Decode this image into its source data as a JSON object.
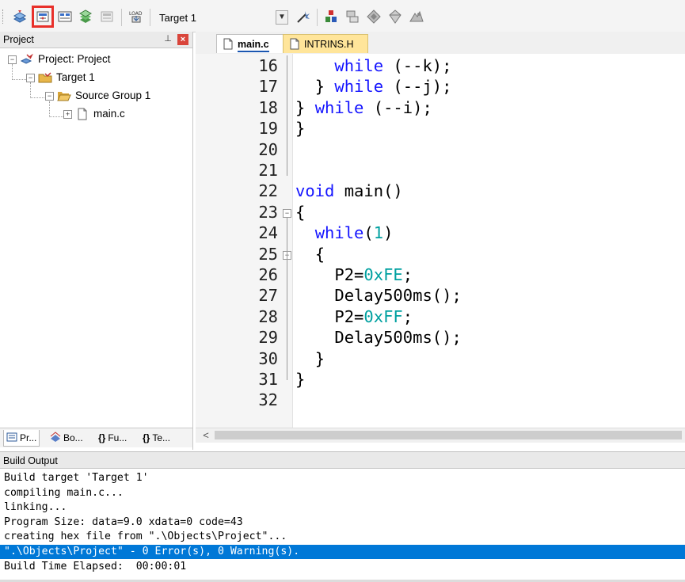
{
  "toolbar": {
    "target_select_value": "Target 1",
    "buttons": [
      "translate-icon",
      "build-icon",
      "rebuild-icon",
      "batch-build-icon",
      "stop-build-icon",
      "download-icon",
      "target-options-icon",
      "manage-components-icon",
      "file-extensions-icon",
      "select-packs-icon",
      "pack-installer-icon",
      "event-recorder-icon"
    ],
    "highlight_color": "#e8302a"
  },
  "project_panel": {
    "title": "Project",
    "pin_glyph": "⊥",
    "close_glyph": "×",
    "tree": {
      "root": "Project: Project",
      "target": "Target 1",
      "group": "Source Group 1",
      "file": "main.c"
    },
    "tabs": [
      "Pr...",
      "Bo...",
      "Fu...",
      "Te..."
    ]
  },
  "editor": {
    "tabs": [
      {
        "label": "main.c",
        "active": true
      },
      {
        "label": "INTRINS.H",
        "active": false
      }
    ],
    "lines": [
      {
        "n": "16",
        "indent": "    ",
        "parts": [
          {
            "t": "while",
            "c": "kw"
          },
          {
            "t": " (--k);",
            "c": ""
          }
        ]
      },
      {
        "n": "17",
        "indent": "  ",
        "parts": [
          {
            "t": "} ",
            "c": ""
          },
          {
            "t": "while",
            "c": "kw"
          },
          {
            "t": " (--j);",
            "c": ""
          }
        ]
      },
      {
        "n": "18",
        "indent": "",
        "parts": [
          {
            "t": "} ",
            "c": ""
          },
          {
            "t": "while",
            "c": "kw"
          },
          {
            "t": " (--i);",
            "c": ""
          }
        ]
      },
      {
        "n": "19",
        "indent": "",
        "parts": [
          {
            "t": "}",
            "c": ""
          }
        ]
      },
      {
        "n": "20",
        "indent": "",
        "parts": []
      },
      {
        "n": "21",
        "indent": "",
        "parts": []
      },
      {
        "n": "22",
        "indent": "",
        "parts": [
          {
            "t": "void",
            "c": "kw"
          },
          {
            "t": " main()",
            "c": ""
          }
        ]
      },
      {
        "n": "23",
        "indent": "",
        "parts": [
          {
            "t": "{",
            "c": ""
          }
        ]
      },
      {
        "n": "24",
        "indent": "  ",
        "parts": [
          {
            "t": "while",
            "c": "kw"
          },
          {
            "t": "(",
            "c": ""
          },
          {
            "t": "1",
            "c": "num"
          },
          {
            "t": ")",
            "c": ""
          }
        ]
      },
      {
        "n": "25",
        "indent": "  ",
        "parts": [
          {
            "t": "{",
            "c": ""
          }
        ]
      },
      {
        "n": "26",
        "indent": "    ",
        "parts": [
          {
            "t": "P2=",
            "c": ""
          },
          {
            "t": "0xFE",
            "c": "num"
          },
          {
            "t": ";",
            "c": ""
          }
        ]
      },
      {
        "n": "27",
        "indent": "    ",
        "parts": [
          {
            "t": "Delay500ms();",
            "c": ""
          }
        ]
      },
      {
        "n": "28",
        "indent": "    ",
        "parts": [
          {
            "t": "P2=",
            "c": ""
          },
          {
            "t": "0xFF",
            "c": "num"
          },
          {
            "t": ";",
            "c": ""
          }
        ]
      },
      {
        "n": "29",
        "indent": "    ",
        "parts": [
          {
            "t": "Delay500ms();",
            "c": ""
          }
        ]
      },
      {
        "n": "30",
        "indent": "  ",
        "parts": [
          {
            "t": "}",
            "c": ""
          }
        ]
      },
      {
        "n": "31",
        "indent": "",
        "parts": [
          {
            "t": "}",
            "c": ""
          }
        ]
      },
      {
        "n": "32",
        "indent": "",
        "parts": []
      }
    ],
    "fold_glyph": "−",
    "scroll_left_glyph": "<"
  },
  "build_output": {
    "title": "Build Output",
    "lines": [
      "Build target 'Target 1'",
      "compiling main.c...",
      "linking...",
      "Program Size: data=9.0 xdata=0 code=43",
      "creating hex file from \".\\Objects\\Project\"...",
      "\".\\Objects\\Project\" - 0 Error(s), 0 Warning(s).",
      "Build Time Elapsed:  00:00:01"
    ],
    "selected_index": 5
  },
  "colors": {
    "keyword": "#1414ff",
    "number": "#00a0a0",
    "selection": "#0078d7",
    "inactive_tab": "#ffe59a"
  }
}
